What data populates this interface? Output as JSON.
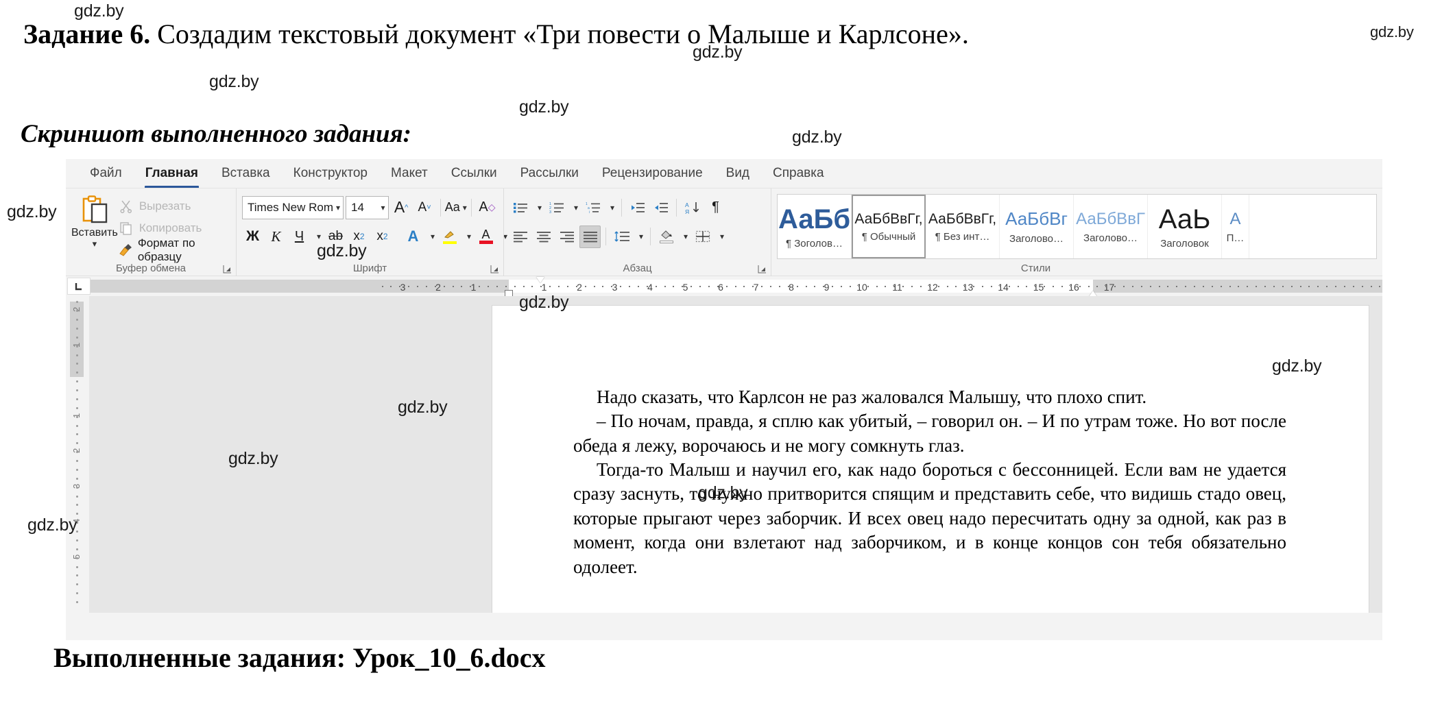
{
  "textbook": {
    "task_label": "Задание 6.",
    "task_text": "Создадим текстовый документ «Три повести о Малыше и Карлсоне».",
    "screenshot_label": "Скриншот выполненного задания:",
    "done_label": "Выполненные задания: Урок_10_6.docx"
  },
  "watermark": {
    "text": "gdz.by"
  },
  "word": {
    "tabs": [
      {
        "label": "Файл",
        "active": false
      },
      {
        "label": "Главная",
        "active": true
      },
      {
        "label": "Вставка",
        "active": false
      },
      {
        "label": "Конструктор",
        "active": false
      },
      {
        "label": "Макет",
        "active": false
      },
      {
        "label": "Ссылки",
        "active": false
      },
      {
        "label": "Рассылки",
        "active": false
      },
      {
        "label": "Рецензирование",
        "active": false
      },
      {
        "label": "Вид",
        "active": false
      },
      {
        "label": "Справка",
        "active": false
      }
    ],
    "clipboard": {
      "group_label": "Буфер обмена",
      "paste_label": "Вставить",
      "cut_label": "Вырезать",
      "copy_label": "Копировать",
      "format_painter_label": "Формат по образцу"
    },
    "font": {
      "group_label": "Шрифт",
      "font_name": "Times New Rom",
      "font_size": "14",
      "grow_label": "A",
      "shrink_label": "A",
      "change_case_label": "Aa",
      "clear_format_label": "A",
      "bold_label": "Ж",
      "italic_label": "К",
      "underline_label": "Ч",
      "strikethrough_label": "ab",
      "subscript_label": "x",
      "subscript_sub": "2",
      "superscript_label": "x",
      "superscript_sup": "2",
      "text_effects_label": "A",
      "highlight_label": "",
      "font_color_label": "A",
      "highlight_color": "#ffff00",
      "font_color": "#e81123"
    },
    "paragraph": {
      "group_label": "Абзац",
      "align_active": "justify"
    },
    "styles": {
      "group_label": "Стили",
      "items": [
        {
          "preview": "АаБб",
          "name": "¶ Зоголов…",
          "color": "#2e5c9a",
          "size": 40,
          "bold": true,
          "selected": false
        },
        {
          "preview": "АаБбВвГг,",
          "name": "¶ Обычный",
          "color": "#1b1b1b",
          "size": 23,
          "bold": false,
          "selected": true
        },
        {
          "preview": "АаБбВвГг,",
          "name": "¶ Без инт…",
          "color": "#1b1b1b",
          "size": 23,
          "bold": false,
          "selected": false
        },
        {
          "preview": "АаБбВг",
          "name": "Заголово…",
          "color": "#4f86c6",
          "size": 27,
          "bold": false,
          "selected": false
        },
        {
          "preview": "АаБбВвГ",
          "name": "Заголово…",
          "color": "#7fa9d8",
          "size": 25,
          "bold": false,
          "selected": false
        },
        {
          "preview": "АаЬ",
          "name": "Заголовок",
          "color": "#1b1b1b",
          "size": 40,
          "bold": false,
          "selected": false
        },
        {
          "preview": "А",
          "name": "П…",
          "color": "#5b8cc4",
          "size": 25,
          "bold": false,
          "selected": false
        }
      ]
    },
    "ruler": {
      "horizontal_ticks": [
        "3",
        "2",
        "1",
        "1",
        "2",
        "3",
        "4",
        "5",
        "6",
        "7",
        "8",
        "9",
        "10",
        "11",
        "12",
        "13",
        "14",
        "15",
        "16",
        "17"
      ],
      "vertical_ticks": [
        "2",
        "1",
        "1",
        "2",
        "3",
        "4",
        "5"
      ]
    },
    "document": {
      "paragraphs": [
        "Надо сказать, что Карлсон не раз жаловался Малышу, что плохо спит.",
        "– По ночам, правда, я сплю как убитый, – говорил он. – И по утрам тоже. Но вот после обеда я лежу, ворочаюсь и не могу сомкнуть глаз.",
        "Тогда-то Малыш и научил его, как надо бороться с бессонницей. Если вам не удается сразу заснуть, то нужно притворится спящим и представить себе, что видишь стадо овец, которые прыгают через заборчик. И всех овец надо пересчитать одну за одной, как раз в момент, когда они взлетают над заборчиком, и в конце концов сон тебя обязательно одолеет."
      ]
    }
  }
}
